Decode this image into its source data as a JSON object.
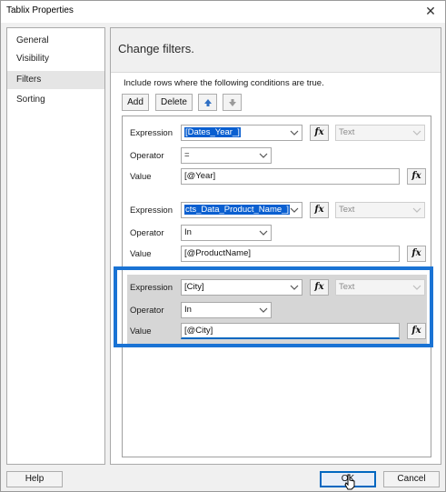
{
  "window": {
    "title": "Tablix Properties",
    "close_glyph": "✕"
  },
  "sidebar": {
    "items": [
      {
        "label": "General"
      },
      {
        "label": "Visibility"
      },
      {
        "label": "Filters",
        "selected": true
      },
      {
        "label": "Sorting"
      }
    ]
  },
  "header": {
    "title": "Change filters."
  },
  "instruction": "Include rows where the following conditions are true.",
  "toolbar": {
    "add_label": "Add",
    "delete_label": "Delete",
    "move_up_icon": "arrow-up-icon",
    "move_down_icon": "arrow-down-icon"
  },
  "labels": {
    "expression": "Expression",
    "operator": "Operator",
    "value": "Value",
    "fx": "fx"
  },
  "filters": [
    {
      "expression": "[Dates_Year_]",
      "expression_highlighted": true,
      "type": "Text",
      "operator": "=",
      "value": "[@Year]"
    },
    {
      "expression": "cts_Data_Product_Name_]",
      "expression_highlighted": true,
      "type": "Text",
      "operator": "In",
      "value": "[@ProductName]"
    },
    {
      "expression": "[City]",
      "expression_highlighted": false,
      "type": "Text",
      "operator": "In",
      "value": "[@City]",
      "selected": true
    }
  ],
  "footer": {
    "help_label": "Help",
    "ok_label": "OK",
    "cancel_label": "Cancel"
  },
  "colors": {
    "accent": "#1a73d4",
    "selection": "#0a5fd0",
    "selected_row": "#d6d6d6"
  }
}
